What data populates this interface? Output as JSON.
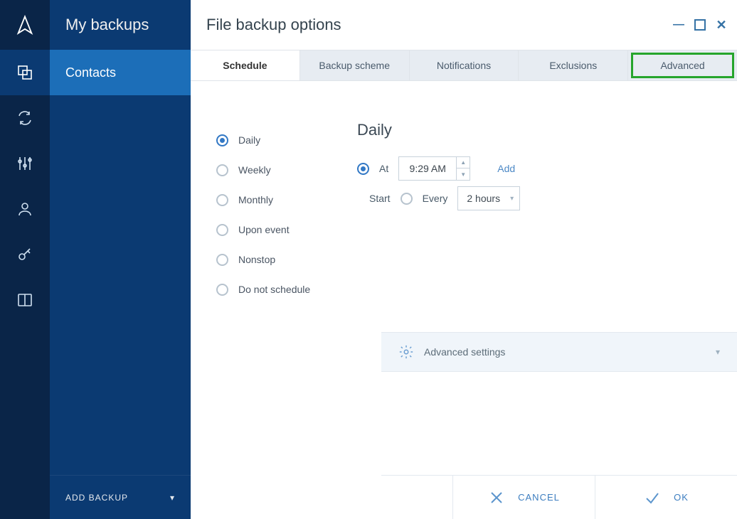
{
  "window": {
    "heading": "File backup options"
  },
  "sidebar_title": "My backups",
  "sidebar_item": "Contacts",
  "add_backup_label": "ADD BACKUP",
  "tabs": {
    "schedule": "Schedule",
    "backup_scheme": "Backup scheme",
    "notifications": "Notifications",
    "exclusions": "Exclusions",
    "advanced": "Advanced"
  },
  "schedule": {
    "options": {
      "daily": "Daily",
      "weekly": "Weekly",
      "monthly": "Monthly",
      "upon_event": "Upon event",
      "nonstop": "Nonstop",
      "do_not_schedule": "Do not schedule"
    },
    "selected": "daily"
  },
  "right": {
    "heading": "Daily",
    "at_label": "At",
    "time": "9:29 AM",
    "add_label": "Add",
    "start_label": "Start",
    "every_label": "Every",
    "every_value": "2 hours"
  },
  "advanced_settings_label": "Advanced settings",
  "footer": {
    "cancel": "CANCEL",
    "ok": "OK"
  }
}
